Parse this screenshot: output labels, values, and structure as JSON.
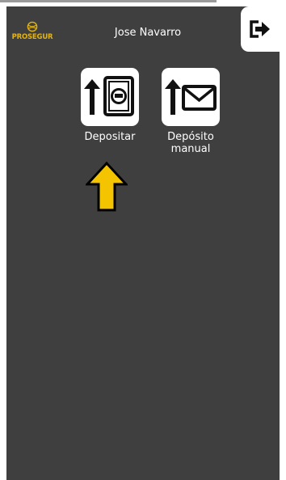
{
  "header": {
    "brand": "PROSEGUR",
    "user_name": "Jose Navarro",
    "logout_icon": "logout-icon"
  },
  "actions": [
    {
      "id": "deposit",
      "label": "Depositar",
      "icon": "banknote-deposit-icon"
    },
    {
      "id": "manual_deposit",
      "label": "Depósito\nmanual",
      "icon": "envelope-deposit-icon"
    }
  ],
  "hint": {
    "icon": "arrow-up-icon"
  },
  "colors": {
    "screen_background": "#3f3f3f",
    "brand_gold": "#e1b413",
    "hint_arrow": "#f5c400"
  }
}
